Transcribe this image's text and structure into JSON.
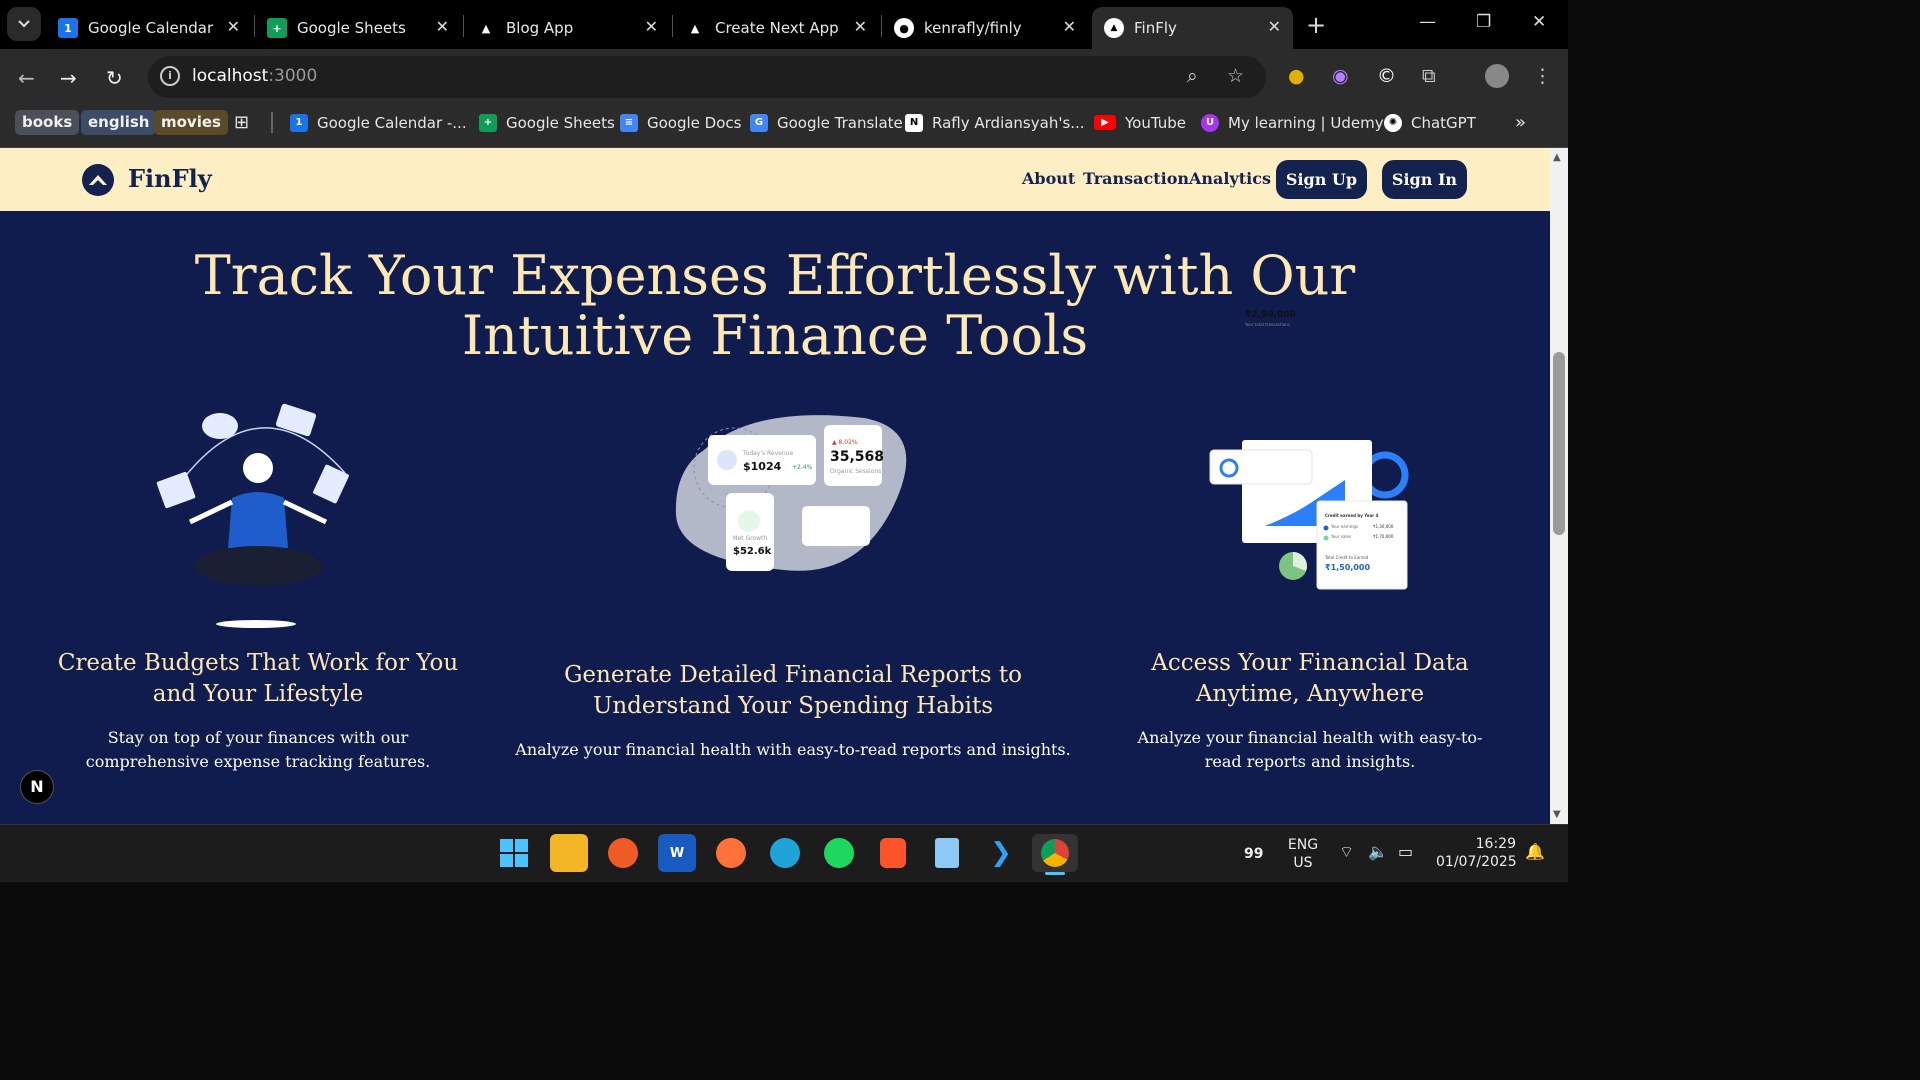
{
  "browser": {
    "tabs": [
      {
        "title": "Google Calendar -",
        "icon": "google-calendar-icon"
      },
      {
        "title": "Google Sheets",
        "icon": "google-sheets-icon"
      },
      {
        "title": "Blog App",
        "icon": "triangle-icon"
      },
      {
        "title": "Create Next App",
        "icon": "triangle-icon"
      },
      {
        "title": "kenrafly/finly",
        "icon": "github-icon"
      },
      {
        "title": "FinFly",
        "icon": "triangle-icon",
        "active": true
      }
    ],
    "url_host": "localhost",
    "url_port": ":3000",
    "bookmark_chips": [
      "books",
      "english",
      "movies"
    ],
    "bookmarks": [
      {
        "label": "Google Calendar -...",
        "icon": "google-calendar-icon",
        "color": "#1a73e8"
      },
      {
        "label": "Google Sheets",
        "icon": "google-sheets-icon",
        "color": "#0f9d58"
      },
      {
        "label": "Google Docs",
        "icon": "google-docs-icon",
        "color": "#4285f4"
      },
      {
        "label": "Google Translate",
        "icon": "google-translate-icon",
        "color": "#4285f4"
      },
      {
        "label": "Rafly Ardiansyah's...",
        "icon": "notion-icon",
        "color": "#ffffff"
      },
      {
        "label": "YouTube",
        "icon": "youtube-icon",
        "color": "#ff0000"
      },
      {
        "label": "My learning | Udemy",
        "icon": "udemy-icon",
        "color": "#a435f0"
      },
      {
        "label": "ChatGPT",
        "icon": "chatgpt-icon",
        "color": "#ffffff"
      }
    ]
  },
  "site": {
    "brand": "FinFly",
    "nav_links": [
      "About",
      "Transaction",
      "Analytics"
    ],
    "signup_label": "Sign Up",
    "signin_label": "Sign In",
    "hero_line1": "Track Your Expenses Effortlessly with Our",
    "hero_line2": "Intuitive Finance Tools",
    "features": [
      {
        "title_line1": "Create Budgets That Work for You",
        "title_line2": "and Your Lifestyle",
        "desc_line1": "Stay on top of your finances with our",
        "desc_line2": "comprehensive expense tracking features."
      },
      {
        "title_line1": "Generate Detailed Financial Reports to",
        "title_line2": "Understand Your Spending Habits",
        "desc_line1": "Analyze your financial health with easy-to-read reports and insights.",
        "desc_line2": ""
      },
      {
        "title_line1": "Access Your Financial Data",
        "title_line2": "Anytime, Anywhere",
        "desc_line1": "Analyze your financial health with easy-to-",
        "desc_line2": "read reports and insights."
      }
    ],
    "report_cards": {
      "revenue_label": "Today's Revenue",
      "revenue_value": "$1024",
      "revenue_delta": "+2.4%",
      "sessions_delta": "▲ 8.02%",
      "sessions_value": "35,568",
      "sessions_label": "Organic Sessions",
      "growth_label": "Net Growth",
      "growth_value": "$52.6k"
    },
    "dashboard_cards": {
      "total_value": "₹2,90,000",
      "total_label": "Your total transactions",
      "credit_title": "Credit earned by Year 4",
      "earnings_label": "Your earnings",
      "earnings_value": "₹1,30,000",
      "sales_label": "Your sales",
      "sales_value": "₹1,70,000",
      "total_credit_label": "Total Credit to Earned",
      "total_credit_value": "₹1,50,000"
    }
  },
  "taskbar": {
    "tray_count": "99",
    "lang_line1": "ENG",
    "lang_line2": "US",
    "time": "16:29",
    "date": "01/07/2025"
  }
}
